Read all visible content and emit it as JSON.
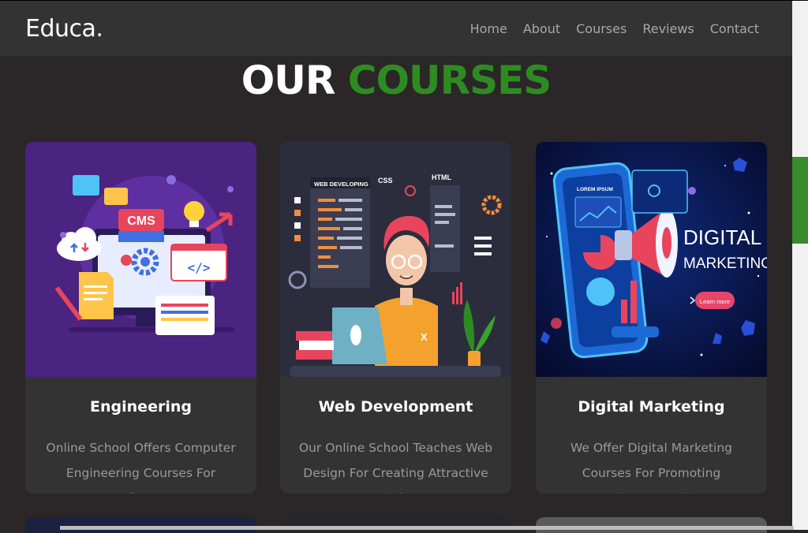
{
  "header": {
    "logo": "Educa.",
    "nav": [
      "Home",
      "About",
      "Courses",
      "Reviews",
      "Contact"
    ]
  },
  "section": {
    "title_white": "OUR",
    "title_green": "COURSES"
  },
  "courses": [
    {
      "title": "Engineering",
      "description": "Online School Offers Computer Engineering Courses For Software",
      "image_icons": [
        "cms-icon",
        "cloud-icon",
        "gear-icon",
        "code-icon",
        "lightbulb-icon",
        "document-icon"
      ],
      "image_text": {
        "cms": "CMS"
      }
    },
    {
      "title": "Web Development",
      "description": "Our Online School Teaches Web Design For Creating Attractive Websites.",
      "image_text": {
        "web": "WEB DEVELOPING",
        "css": "CSS",
        "html": "HTML",
        "x": "X"
      }
    },
    {
      "title": "Digital Marketing",
      "description": "We Offer Digital Marketing Courses For Promoting Businesses Online.",
      "image_text": {
        "line1": "DIGITAL",
        "line2": "MARKETING",
        "lorem": "LOREM IPSUM",
        "learn": "Learn more"
      }
    }
  ],
  "colors": {
    "accent": "#2e8b22",
    "header_bg": "#333333",
    "page_bg": "#2b2627",
    "card_bg": "#333333"
  }
}
